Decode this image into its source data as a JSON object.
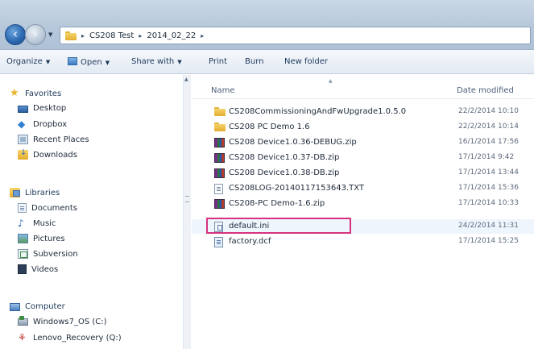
{
  "address_bar": {
    "crumbs": [
      "CS208 Test",
      "2014_02_22"
    ]
  },
  "toolbar": {
    "organize": "Organize",
    "open": "Open",
    "share_with": "Share with",
    "print": "Print",
    "burn": "Burn",
    "new_folder": "New folder"
  },
  "nav": {
    "favorites": {
      "label": "Favorites",
      "items": [
        "Desktop",
        "Dropbox",
        "Recent Places",
        "Downloads"
      ]
    },
    "libraries": {
      "label": "Libraries",
      "items": [
        "Documents",
        "Music",
        "Pictures",
        "Subversion",
        "Videos"
      ]
    },
    "computer": {
      "label": "Computer",
      "items": [
        "Windows7_OS (C:)",
        "Lenovo_Recovery (Q:)"
      ]
    }
  },
  "columns": {
    "name": "Name",
    "date_modified": "Date modified"
  },
  "files": [
    {
      "name": "CS208CommissioningAndFwUpgrade1.0.5.0",
      "date": "22/2/2014 10:10",
      "type": "folder"
    },
    {
      "name": "CS208 PC Demo 1.6",
      "date": "22/2/2014 10:14",
      "type": "folder"
    },
    {
      "name": "CS208 Device1.0.36-DEBUG.zip",
      "date": "16/1/2014 17:56",
      "type": "zip"
    },
    {
      "name": "CS208 Device1.0.37-DB.zip",
      "date": "17/1/2014 9:42",
      "type": "zip"
    },
    {
      "name": "CS208 Device1.0.38-DB.zip",
      "date": "17/1/2014 13:44",
      "type": "zip"
    },
    {
      "name": "CS208LOG-20140117153643.TXT",
      "date": "17/1/2014 15:36",
      "type": "txt"
    },
    {
      "name": "CS208-PC Demo-1.6.zip",
      "date": "17/1/2014 10:33",
      "type": "zip"
    },
    {
      "name": "default.ini",
      "date": "24/2/2014 11:31",
      "type": "ini",
      "highlighted": true
    },
    {
      "name": "factory.dcf",
      "date": "17/1/2014 15:25",
      "type": "dcf"
    }
  ],
  "colors": {
    "highlight_border": "#d6317e",
    "folder": "#e3ad2f"
  }
}
